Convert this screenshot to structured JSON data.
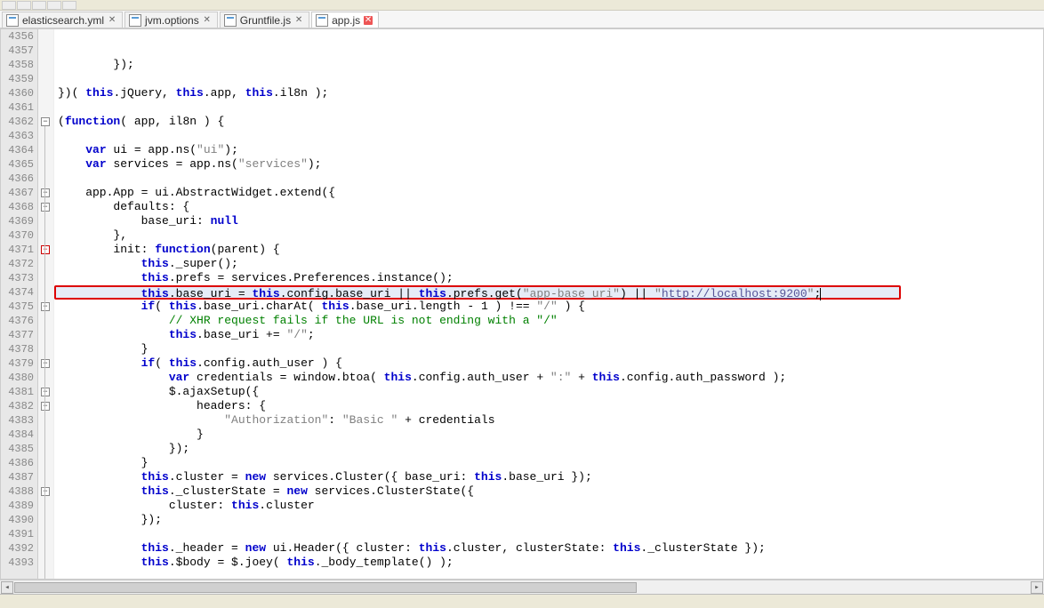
{
  "tabs": [
    {
      "label": "elasticsearch.yml",
      "active": false,
      "closeRed": false
    },
    {
      "label": "jvm.options",
      "active": false,
      "closeRed": false
    },
    {
      "label": "Gruntfile.js",
      "active": false,
      "closeRed": false
    },
    {
      "label": "app.js",
      "active": true,
      "closeRed": true
    }
  ],
  "close_glyph": "✕",
  "first_line_no": 4356,
  "code_lines": [
    {
      "n": 4356,
      "html": ""
    },
    {
      "n": 4357,
      "html": ""
    },
    {
      "n": 4358,
      "html": "        });"
    },
    {
      "n": 4359,
      "html": ""
    },
    {
      "n": 4360,
      "html": "})( <span class='kw'>this</span>.jQuery, <span class='kw'>this</span>.app, <span class='kw'>this</span>.il8n );"
    },
    {
      "n": 4361,
      "html": ""
    },
    {
      "n": 4362,
      "html": "(<span class='kw'>function</span>( app, il8n ) {",
      "fold": "minus"
    },
    {
      "n": 4363,
      "html": ""
    },
    {
      "n": 4364,
      "html": "    <span class='kw'>var</span> ui = app.ns(<span class='str'>\"ui\"</span>);"
    },
    {
      "n": 4365,
      "html": "    <span class='kw'>var</span> services = app.ns(<span class='str'>\"services\"</span>);"
    },
    {
      "n": 4366,
      "html": ""
    },
    {
      "n": 4367,
      "html": "    app.App = ui.AbstractWidget.extend({",
      "fold": "minus"
    },
    {
      "n": 4368,
      "html": "        defaults: {",
      "fold": "minus"
    },
    {
      "n": 4369,
      "html": "            base_uri: <span class='kw'>null</span>"
    },
    {
      "n": 4370,
      "html": "        },"
    },
    {
      "n": 4371,
      "html": "        init: <span class='kw'>function</span>(parent) {",
      "fold": "minus-red"
    },
    {
      "n": 4372,
      "html": "            <span class='kw'>this</span>._super();"
    },
    {
      "n": 4373,
      "html": "            <span class='kw'>this</span>.prefs = services.Preferences.instance();"
    },
    {
      "n": 4374,
      "hl": true,
      "box": true,
      "html": "            <span class='kw'>this</span>.base_uri = <span class='kw'>this</span>.config.base_uri || <span class='kw'>this</span>.prefs.get(<span class='str'>\"app-base_uri\"</span>) || <span class='str'>\"<span class='url'>http://localhost:9200</span>\"</span>;<span class='cursor'></span>"
    },
    {
      "n": 4375,
      "html": "            <span class='kw'>if</span>( <span class='kw'>this</span>.base_uri.charAt( <span class='kw'>this</span>.base_uri.length - 1 ) !== <span class='str'>\"/\"</span> ) {",
      "fold": "minus"
    },
    {
      "n": 4376,
      "html": "                <span class='com'>// XHR request fails if the URL is not ending with a \"/\"</span>"
    },
    {
      "n": 4377,
      "html": "                <span class='kw'>this</span>.base_uri += <span class='str'>\"/\"</span>;"
    },
    {
      "n": 4378,
      "html": "            }"
    },
    {
      "n": 4379,
      "html": "            <span class='kw'>if</span>( <span class='kw'>this</span>.config.auth_user ) {",
      "fold": "minus"
    },
    {
      "n": 4380,
      "html": "                <span class='kw'>var</span> credentials = window.btoa( <span class='kw'>this</span>.config.auth_user + <span class='str'>\":\"</span> + <span class='kw'>this</span>.config.auth_password );"
    },
    {
      "n": 4381,
      "html": "                $.ajaxSetup({",
      "fold": "minus"
    },
    {
      "n": 4382,
      "html": "                    headers: {",
      "fold": "minus"
    },
    {
      "n": 4383,
      "html": "                        <span class='str'>\"Authorization\"</span>: <span class='str'>\"Basic \"</span> + credentials"
    },
    {
      "n": 4384,
      "html": "                    }"
    },
    {
      "n": 4385,
      "html": "                });"
    },
    {
      "n": 4386,
      "html": "            }"
    },
    {
      "n": 4387,
      "html": "            <span class='kw'>this</span>.cluster = <span class='kw'>new</span> services.Cluster({ base_uri: <span class='kw'>this</span>.base_uri });"
    },
    {
      "n": 4388,
      "html": "            <span class='kw'>this</span>._clusterState = <span class='kw'>new</span> services.ClusterState({",
      "fold": "minus"
    },
    {
      "n": 4389,
      "html": "                cluster: <span class='kw'>this</span>.cluster"
    },
    {
      "n": 4390,
      "html": "            });"
    },
    {
      "n": 4391,
      "html": ""
    },
    {
      "n": 4392,
      "html": "            <span class='kw'>this</span>._header = <span class='kw'>new</span> ui.Header({ cluster: <span class='kw'>this</span>.cluster, clusterState: <span class='kw'>this</span>._clusterState });"
    },
    {
      "n": 4393,
      "html": "            <span class='kw'>this</span>.$body = $.joey( <span class='kw'>this</span>._body_template() );"
    }
  ]
}
